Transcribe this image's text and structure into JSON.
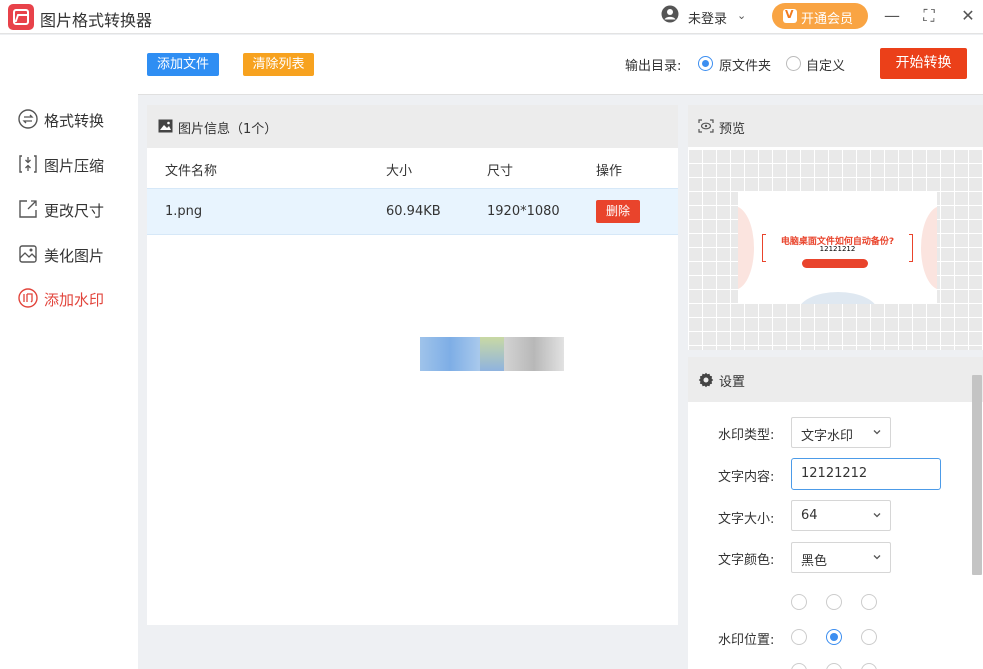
{
  "app": {
    "title": "图片格式转换器"
  },
  "account": {
    "user_label": "未登录",
    "vip_label": "开通会员"
  },
  "window": {
    "minimize": "—",
    "maximize": "⛶",
    "close": "✕"
  },
  "sidebar": {
    "items": [
      {
        "label": "格式转换",
        "icon": "format-convert-icon",
        "active": false
      },
      {
        "label": "图片压缩",
        "icon": "compress-icon",
        "active": false
      },
      {
        "label": "更改尺寸",
        "icon": "resize-icon",
        "active": false
      },
      {
        "label": "美化图片",
        "icon": "beautify-icon",
        "active": false
      },
      {
        "label": "添加水印",
        "icon": "watermark-icon",
        "active": true
      }
    ]
  },
  "toolbar": {
    "add_file": "添加文件",
    "clear_list": "清除列表",
    "output_label": "输出目录:",
    "output_options": [
      {
        "label": "原文件夹",
        "selected": true
      },
      {
        "label": "自定义",
        "selected": false
      }
    ],
    "start": "开始转换"
  },
  "file_panel": {
    "title": "图片信息（1个）",
    "columns": [
      "文件名称",
      "大小",
      "尺寸",
      "操作"
    ],
    "rows": [
      {
        "name": "1.png",
        "size": "60.94KB",
        "dimensions": "1920*1080",
        "action": "删除"
      }
    ]
  },
  "preview": {
    "title": "预览",
    "image_headline": "电脑桌面文件如何自动备份?",
    "image_watermark": "12121212"
  },
  "settings": {
    "title": "设置",
    "watermark_type": {
      "label": "水印类型:",
      "value": "文字水印"
    },
    "text_content": {
      "label": "文字内容:",
      "value": "12121212"
    },
    "text_size": {
      "label": "文字大小:",
      "value": "64"
    },
    "text_color": {
      "label": "文字颜色:",
      "value": "黑色"
    },
    "position": {
      "label": "水印位置:",
      "selected_row": 2,
      "selected_col": 2
    }
  },
  "colors": {
    "accent_blue": "#2f8ef3",
    "accent_orange": "#f7a21f",
    "danger_red": "#eb4019",
    "active_nav": "#e2453c"
  }
}
